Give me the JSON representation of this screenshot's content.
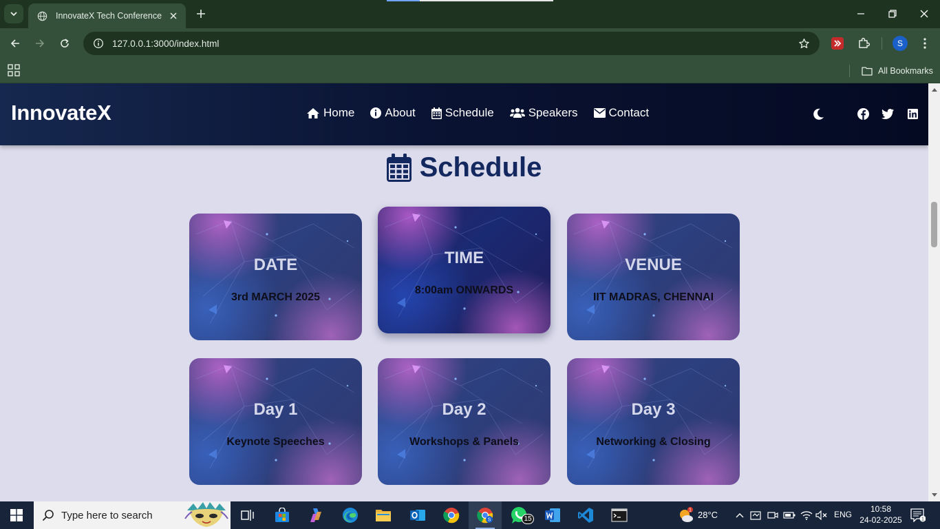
{
  "browser": {
    "tab_title": "InnovateX Tech Conference",
    "url": "127.0.0.1:3000/index.html",
    "bookmarks_label": "All Bookmarks",
    "profile_initial": "S"
  },
  "site": {
    "brand": "InnovateX",
    "nav": [
      {
        "label": "Home",
        "icon": "home-icon"
      },
      {
        "label": "About",
        "icon": "info-icon"
      },
      {
        "label": "Schedule",
        "icon": "calendar-icon"
      },
      {
        "label": "Speakers",
        "icon": "users-icon"
      },
      {
        "label": "Contact",
        "icon": "envelope-icon"
      }
    ],
    "social": [
      "facebook-icon",
      "twitter-icon",
      "linkedin-icon"
    ],
    "theme_toggle_icon": "moon-icon"
  },
  "schedule": {
    "heading": "Schedule",
    "cards": [
      {
        "title": "DATE",
        "subtitle": "3rd MARCH 2025"
      },
      {
        "title": "TIME",
        "subtitle": "8:00am ONWARDS"
      },
      {
        "title": "VENUE",
        "subtitle": "IIT MADRAS, CHENNAI"
      },
      {
        "title": "Day 1",
        "subtitle": "Keynote Speeches"
      },
      {
        "title": "Day 2",
        "subtitle": "Workshops & Panels"
      },
      {
        "title": "Day 3",
        "subtitle": "Networking & Closing"
      }
    ]
  },
  "taskbar": {
    "search_placeholder": "Type here to search",
    "weather_temp": "28°C",
    "weather_badge": "1",
    "whatsapp_badge": "15",
    "language": "ENG",
    "time": "10:58",
    "date": "24-02-2025",
    "notification_count": "1"
  },
  "colors": {
    "chrome_dark": "#1e3320",
    "chrome_mid": "#34503a",
    "nav_bg": "#0a1333",
    "page_bg": "#dcdcec",
    "heading": "#13285e",
    "taskbar": "#17243a"
  }
}
